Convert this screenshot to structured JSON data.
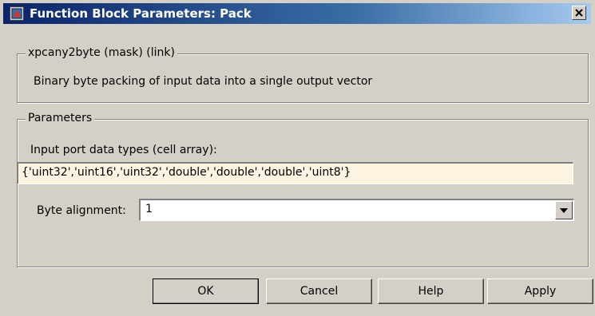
{
  "window": {
    "title": "Function Block Parameters: Pack",
    "icon": "simulink-block-icon",
    "close_icon": "close-icon"
  },
  "mask_group": {
    "legend": "xpcany2byte (mask) (link)",
    "description": "Binary byte packing of input data into a single output vector"
  },
  "params_group": {
    "legend": "Parameters",
    "input_types_label": "Input port data types (cell array):",
    "input_types_value": "{'uint32','uint16','uint32','double','double','double','uint8'}",
    "byte_alignment_label": "Byte alignment:",
    "byte_alignment_value": "1"
  },
  "buttons": {
    "ok": "OK",
    "cancel": "Cancel",
    "help": "Help",
    "apply": "Apply"
  },
  "colors": {
    "titlebar_start": "#0a246a",
    "titlebar_end": "#a6caf0",
    "dialog_bg": "#d4d0c8",
    "edit_field_bg": "#fdf3e1"
  }
}
